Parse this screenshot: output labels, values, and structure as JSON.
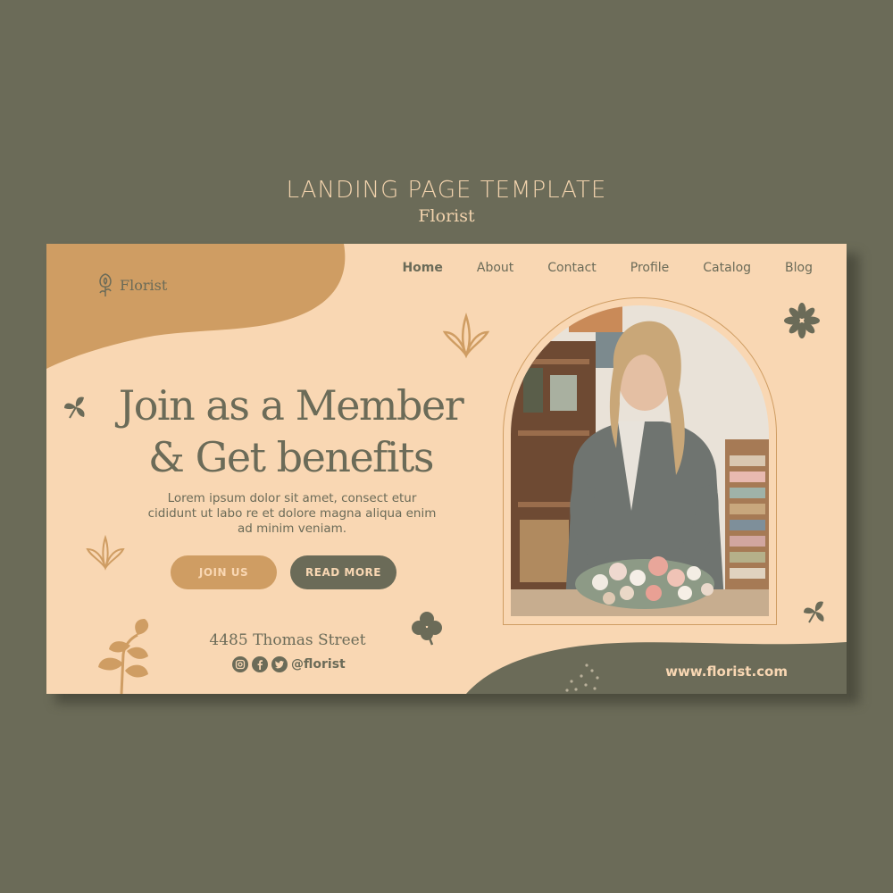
{
  "header": {
    "title": "LANDING PAGE TEMPLATE",
    "subtitle": "Florist"
  },
  "logo": {
    "text": "Florist",
    "icon": "rose-icon"
  },
  "nav": {
    "items": [
      {
        "label": "Home",
        "active": true
      },
      {
        "label": "About",
        "active": false
      },
      {
        "label": "Contact",
        "active": false
      },
      {
        "label": "Profile",
        "active": false
      },
      {
        "label": "Catalog",
        "active": false
      },
      {
        "label": "Blog",
        "active": false
      }
    ]
  },
  "hero": {
    "headline_line1": "Join as a Member",
    "headline_line2": "& Get benefits",
    "body": "Lorem ipsum dolor sit amet, consect etur cididunt ut labo re et dolore magna aliqua enim ad minim veniam.",
    "join_label": "JOIN US",
    "read_more_label": "READ MORE"
  },
  "contact": {
    "address": "4485  Thomas Street",
    "handle": "@florist",
    "social_icons": [
      "instagram-icon",
      "facebook-icon",
      "twitter-icon"
    ]
  },
  "footer": {
    "website": "www.florist.com"
  },
  "colors": {
    "background": "#6b6b58",
    "card": "#f9d7b3",
    "accent": "#cf9d63",
    "olive": "#6b6b58"
  }
}
